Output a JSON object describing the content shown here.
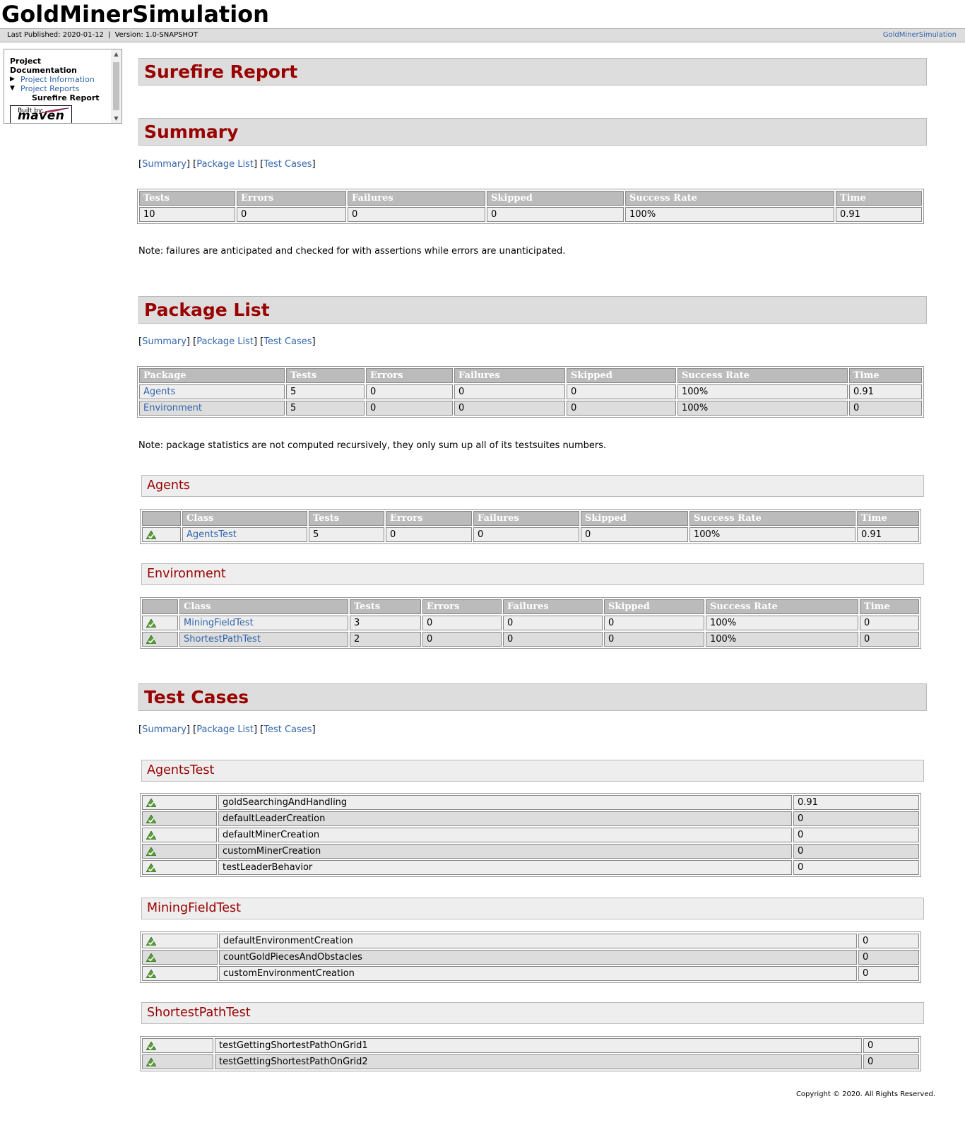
{
  "banner": {
    "title": "GoldMinerSimulation"
  },
  "breadcrumbs": {
    "last_published": "Last Published: 2020-01-12",
    "separator": "|",
    "version": "Version: 1.0-SNAPSHOT",
    "right_link": "GoldMinerSimulation"
  },
  "nav": {
    "heading": "Project Documentation",
    "items": [
      {
        "label": "Project Information",
        "state": "collapsed"
      },
      {
        "label": "Project Reports",
        "state": "expanded"
      },
      {
        "label": "Surefire Report",
        "state": "selected"
      }
    ],
    "built_by": "Built by:",
    "maven": "maven"
  },
  "report": {
    "title": "Surefire Report",
    "quicklinks": {
      "summary": "Summary",
      "packages": "Package List",
      "testcases": "Test Cases"
    },
    "summary": {
      "heading": "Summary",
      "headers": [
        "Tests",
        "Errors",
        "Failures",
        "Skipped",
        "Success Rate",
        "Time"
      ],
      "row": [
        "10",
        "0",
        "0",
        "0",
        "100%",
        "0.91"
      ],
      "note": "Note: failures are anticipated and checked for with assertions while errors are unanticipated."
    },
    "packages": {
      "heading": "Package List",
      "headers": [
        "Package",
        "Tests",
        "Errors",
        "Failures",
        "Skipped",
        "Success Rate",
        "Time"
      ],
      "rows": [
        [
          "Agents",
          "5",
          "0",
          "0",
          "0",
          "100%",
          "0.91"
        ],
        [
          "Environment",
          "5",
          "0",
          "0",
          "0",
          "100%",
          "0"
        ]
      ],
      "note": "Note: package statistics are not computed recursively, they only sum up all of its testsuites numbers."
    },
    "package_sections": [
      {
        "name": "Agents",
        "headers": [
          "",
          "Class",
          "Tests",
          "Errors",
          "Failures",
          "Skipped",
          "Success Rate",
          "Time"
        ],
        "rows": [
          [
            "AgentsTest",
            "5",
            "0",
            "0",
            "0",
            "100%",
            "0.91"
          ]
        ]
      },
      {
        "name": "Environment",
        "headers": [
          "",
          "Class",
          "Tests",
          "Errors",
          "Failures",
          "Skipped",
          "Success Rate",
          "Time"
        ],
        "rows": [
          [
            "MiningFieldTest",
            "3",
            "0",
            "0",
            "0",
            "100%",
            "0"
          ],
          [
            "ShortestPathTest",
            "2",
            "0",
            "0",
            "0",
            "100%",
            "0"
          ]
        ]
      }
    ],
    "testcases": {
      "heading": "Test Cases",
      "suites": [
        {
          "name": "AgentsTest",
          "cases": [
            [
              "goldSearchingAndHandling",
              "0.91"
            ],
            [
              "defaultLeaderCreation",
              "0"
            ],
            [
              "defaultMinerCreation",
              "0"
            ],
            [
              "customMinerCreation",
              "0"
            ],
            [
              "testLeaderBehavior",
              "0"
            ]
          ]
        },
        {
          "name": "MiningFieldTest",
          "cases": [
            [
              "defaultEnvironmentCreation",
              "0"
            ],
            [
              "countGoldPiecesAndObstacles",
              "0"
            ],
            [
              "customEnvironmentCreation",
              "0"
            ]
          ]
        },
        {
          "name": "ShortestPathTest",
          "cases": [
            [
              "testGettingShortestPathOnGrid1",
              "0"
            ],
            [
              "testGettingShortestPathOnGrid2",
              "0"
            ]
          ]
        }
      ]
    }
  },
  "footer": {
    "copyright": "Copyright © 2020. All Rights Reserved."
  },
  "colors": {
    "heading": "#990000",
    "link": "#3366aa",
    "header_bg": "#bbbbbb",
    "row_bg": "#dddddd"
  },
  "icons": {
    "success": "success-icon"
  }
}
